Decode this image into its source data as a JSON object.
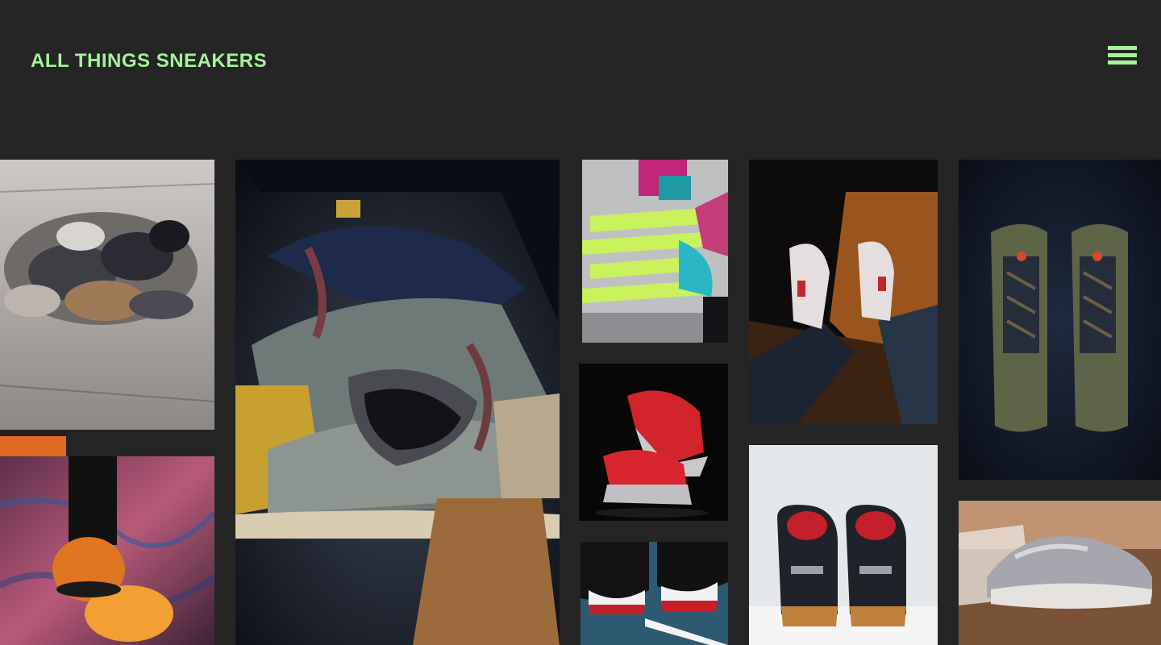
{
  "header": {
    "title": "ALL THINGS SNEAKERS"
  },
  "colors": {
    "background": "#252525",
    "accent": "#a6f39a"
  },
  "icons": {
    "menu": "hamburger-menu-icon"
  },
  "gallery": {
    "photos": [
      "pile-of-sneakers-photo",
      "travis-scott-air-force-1-closeup-photo",
      "neon-laces-air-force-1-photo",
      "red-white-sneakers-on-feet-photo",
      "travis-scott-jordan-6-olive-photo",
      "orange-air-max-720-on-feet-photo",
      "red-metallic-sneakers-photo",
      "nike-red-black-heels-photo",
      "jordan-11-bred-photo",
      "yeezy-700-grey-photo"
    ]
  }
}
